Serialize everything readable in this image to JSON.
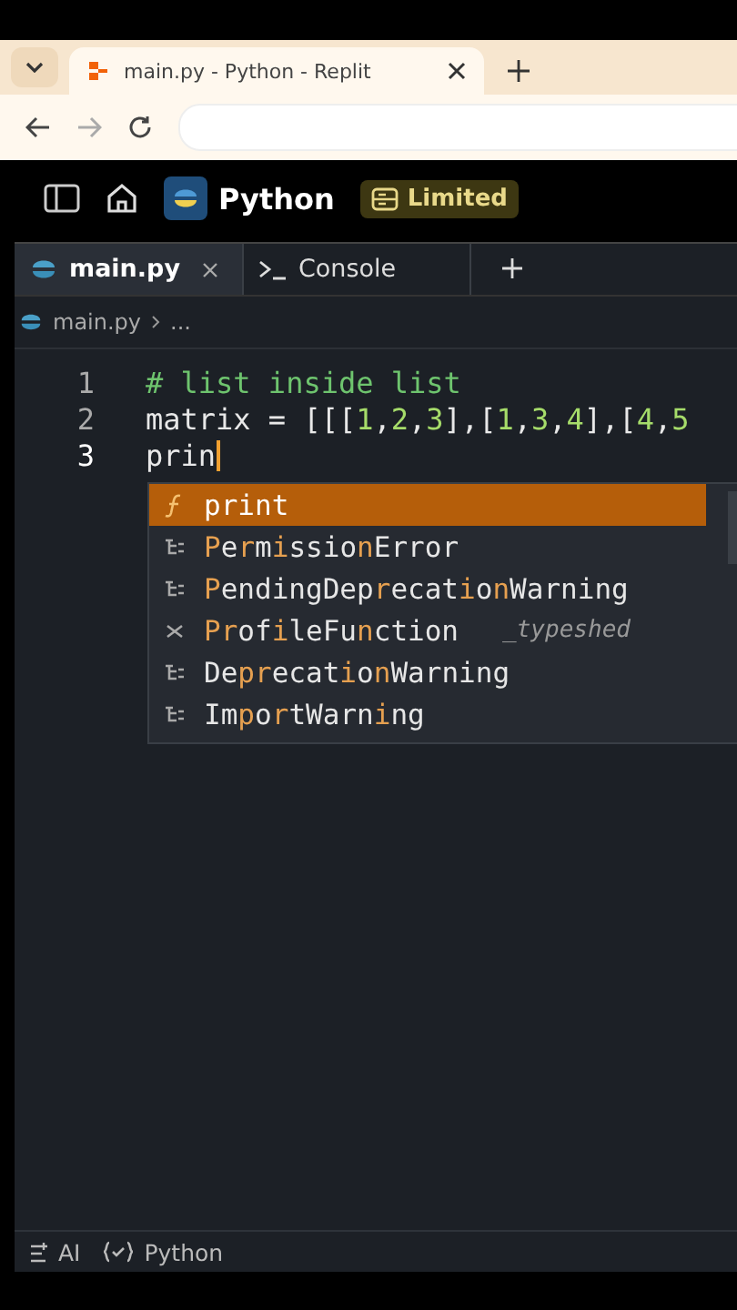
{
  "browser": {
    "tab_title": "main.py - Python - Replit"
  },
  "header": {
    "project": "Python",
    "badge": "Limited"
  },
  "editor_tabs": [
    {
      "label": "main.py",
      "kind": "file",
      "selected": true
    },
    {
      "label": "Console",
      "kind": "console",
      "selected": false
    }
  ],
  "breadcrumb": [
    "main.py",
    "..."
  ],
  "code_lines": [
    {
      "number": "1",
      "kind": "comment",
      "text": "# list inside list"
    },
    {
      "number": "2",
      "kind": "code",
      "text": "matrix = [[[1,2,3],[1,3,4],[4,5"
    },
    {
      "number": "3",
      "kind": "typing",
      "text": "prin"
    }
  ],
  "suggestions": [
    {
      "kind": "function",
      "label": "print",
      "selected": true
    },
    {
      "kind": "class",
      "label": "**P**e**r**m**i**ssio**n**Error",
      "selected": false
    },
    {
      "kind": "class",
      "label": "**P**endingDep**r**ecat**i**o**n**Warning",
      "selected": false
    },
    {
      "kind": "variable",
      "label": "**Pr**of**i**leFu**n**ction",
      "detail": "_typeshed",
      "selected": false
    },
    {
      "kind": "class",
      "label": "De**pr**ecat**i**o**n**Warning",
      "selected": false
    },
    {
      "kind": "class",
      "label": "Im**p**o**r**tWarn**i**ng",
      "selected": false
    }
  ],
  "status_bar": [
    "AI",
    "Python"
  ]
}
